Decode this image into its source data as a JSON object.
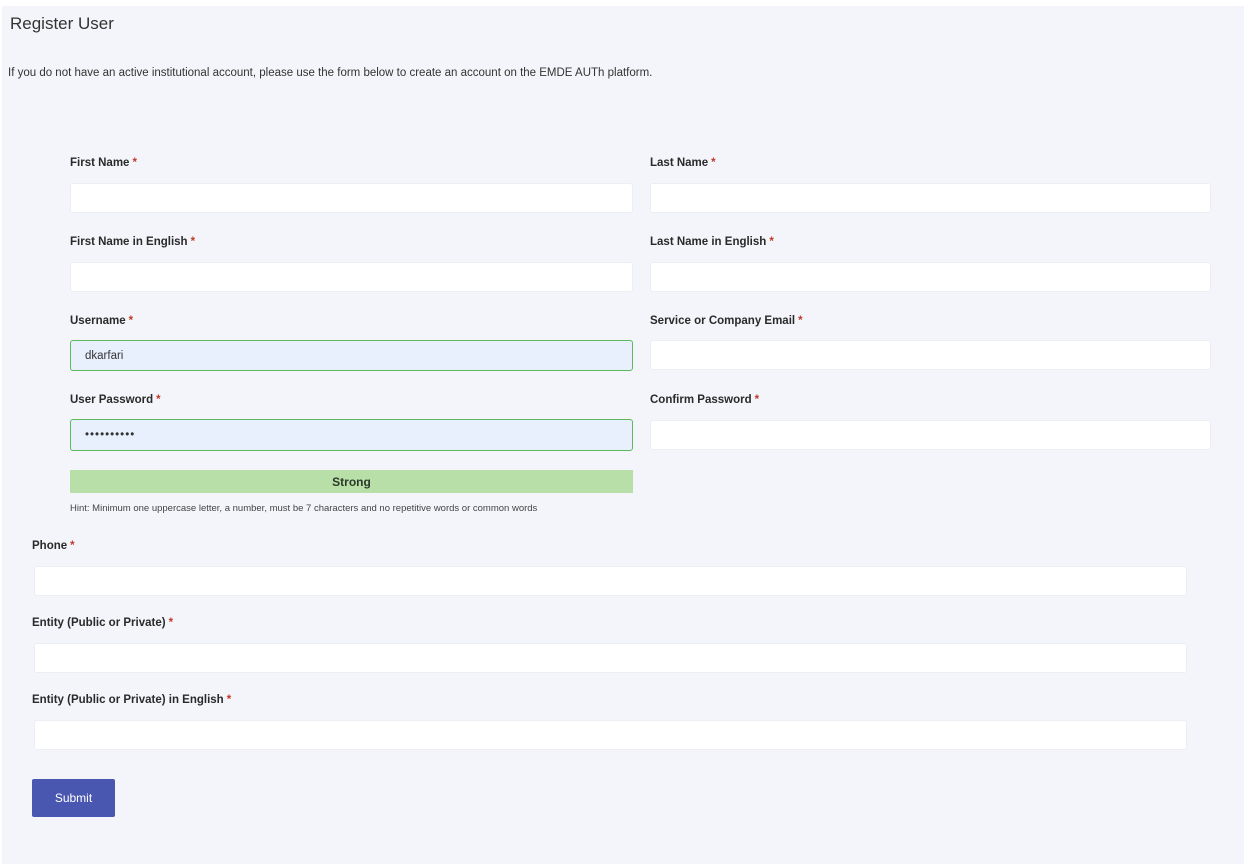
{
  "page": {
    "title": "Register User",
    "intro": "If you do not have an active institutional account, please use the form below to create an account on the EMDE AUTh platform."
  },
  "required_marker": "*",
  "form": {
    "first_name": {
      "label": "First Name",
      "value": ""
    },
    "last_name": {
      "label": "Last Name",
      "value": ""
    },
    "first_name_en": {
      "label": "First Name in English",
      "value": ""
    },
    "last_name_en": {
      "label": "Last Name in English",
      "value": ""
    },
    "username": {
      "label": "Username",
      "value": "dkarfari"
    },
    "email": {
      "label": "Service or Company Email",
      "value": ""
    },
    "password": {
      "label": "User Password",
      "value": "••••••••••"
    },
    "confirm_password": {
      "label": "Confirm Password",
      "value": ""
    },
    "password_strength": "Strong",
    "password_hint": "Hint: Minimum one uppercase letter, a number, must be 7 characters and no repetitive words or common words",
    "phone": {
      "label": "Phone",
      "value": ""
    },
    "entity": {
      "label": "Entity (Public or Private)",
      "value": ""
    },
    "entity_en": {
      "label": "Entity (Public or Private) in English",
      "value": ""
    },
    "submit_label": "Submit"
  },
  "colors": {
    "page_bg": "#f4f5fa",
    "valid_border": "#5cb85c",
    "valid_fill": "#e8f0fe",
    "strength_bar": "#b9dfa8",
    "submit_button": "#4a57b0",
    "required": "#c0392b"
  }
}
